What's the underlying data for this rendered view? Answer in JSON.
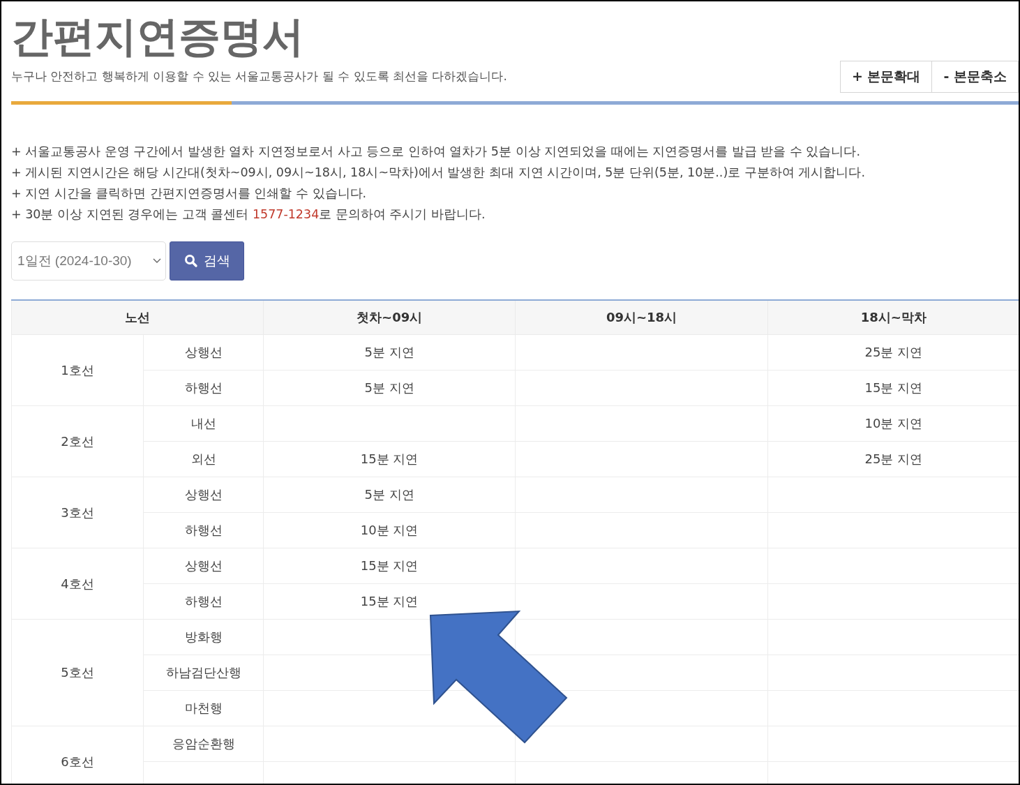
{
  "header": {
    "title": "간편지연증명서",
    "subtitle": "누구나 안전하고 행복하게 이용할 수 있는 서울교통공사가 될 수 있도록 최선을 다하겠습니다.",
    "buttons": [
      "+ 본문확대",
      "- 본문축소"
    ]
  },
  "notes": [
    {
      "text": "+ 서울교통공사 운영 구간에서 발생한 열차 지연정보로서 사고 등으로 인하여 열차가 5분 이상 지연되었을 때에는 지연증명서를 발급 받을 수 있습니다."
    },
    {
      "text": "+ 게시된 지연시간은 해당 시간대(첫차~09시, 09시~18시, 18시~막차)에서 발생한 최대 지연 시간이며, 5분 단위(5분, 10분..)로 구분하여 게시합니다."
    },
    {
      "text": "+ 지연 시간을 클릭하면 간편지연증명서를 인쇄할 수 있습니다."
    },
    {
      "text": "+ 30분 이상 지연된 경우에는 고객 콜센터 ",
      "highlight": "1577-1234",
      "text_after": "로 문의하여 주시기 바랍니다."
    }
  ],
  "search": {
    "date_select": "1일전 (2024-10-30)",
    "button": "검색"
  },
  "table": {
    "columns": [
      "노선",
      "첫차~09시",
      "09시~18시",
      "18시~막차"
    ],
    "lines": [
      {
        "name": "1호선",
        "directions": [
          {
            "name": "상행선",
            "first": "5분 지연",
            "night": "25분 지연"
          },
          {
            "name": "하행선",
            "first": "5분 지연",
            "night": "15분 지연"
          }
        ]
      },
      {
        "name": "2호선",
        "directions": [
          {
            "name": "내선",
            "night": "10분 지연"
          },
          {
            "name": "외선",
            "first": "15분 지연",
            "night": "25분 지연"
          }
        ]
      },
      {
        "name": "3호선",
        "directions": [
          {
            "name": "상행선",
            "first": "5분 지연"
          },
          {
            "name": "하행선",
            "first": "10분 지연"
          }
        ]
      },
      {
        "name": "4호선",
        "directions": [
          {
            "name": "상행선",
            "first": "15분 지연"
          },
          {
            "name": "하행선",
            "first": "15분 지연"
          }
        ]
      },
      {
        "name": "5호선",
        "directions": [
          {
            "name": "방화행"
          },
          {
            "name": "하남검단산행"
          },
          {
            "name": "마천행"
          }
        ]
      },
      {
        "name": "6호선",
        "directions": [
          {
            "name": "응암순환행"
          }
        ],
        "continues_below": true
      }
    ]
  },
  "annotation": {
    "kind": "arrow"
  }
}
